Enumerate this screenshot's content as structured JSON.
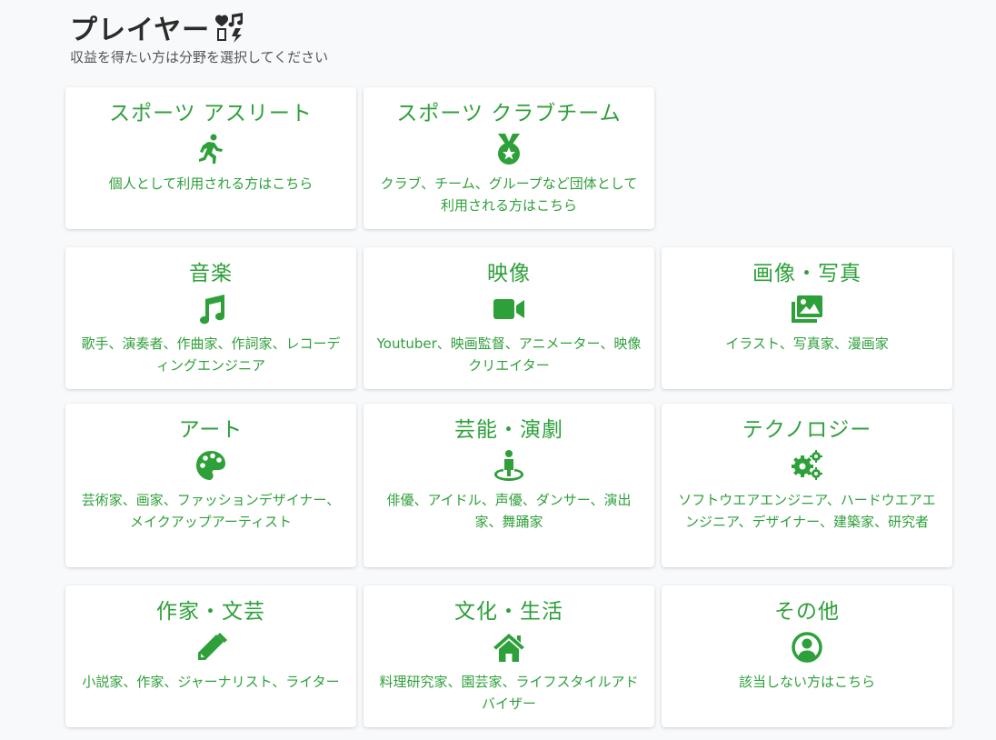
{
  "header": {
    "title": "プレイヤー",
    "title_icon": "music-heart-icon",
    "subtitle": "収益を得たい方は分野を選択してください"
  },
  "accent_color": "#2ea03a",
  "cards": [
    {
      "title": "スポーツ アスリート",
      "icon": "running-icon",
      "description": "個人として利用される方はこちら"
    },
    {
      "title": "スポーツ クラブチーム",
      "icon": "medal-icon",
      "description": "クラブ、チーム、グループなど団体として利用される方はこちら"
    },
    {
      "title": "音楽",
      "icon": "music-note-icon",
      "description": "歌手、演奏者、作曲家、作詞家、レコーディングエンジニア"
    },
    {
      "title": "映像",
      "icon": "video-camera-icon",
      "description": "Youtuber、映画監督、アニメーター、映像クリエイター"
    },
    {
      "title": "画像・写真",
      "icon": "images-icon",
      "description": "イラスト、写真家、漫画家"
    },
    {
      "title": "アート",
      "icon": "palette-icon",
      "description": "芸術家、画家、ファッションデザイナー、メイクアップアーティスト"
    },
    {
      "title": "芸能・演劇",
      "icon": "person-stage-icon",
      "description": "俳優、アイドル、声優、ダンサー、演出家、舞踊家"
    },
    {
      "title": "テクノロジー",
      "icon": "gears-icon",
      "description": "ソフトウエアエンジニア、ハードウエアエンジニア、デザイナー、建築家、研究者"
    },
    {
      "title": "作家・文芸",
      "icon": "pencil-icon",
      "description": "小説家、作家、ジャーナリスト、ライター"
    },
    {
      "title": "文化・生活",
      "icon": "home-icon",
      "description": "料理研究家、園芸家、ライフスタイルアドバイザー"
    },
    {
      "title": "その他",
      "icon": "user-circle-icon",
      "description": "該当しない方はこちら"
    }
  ]
}
